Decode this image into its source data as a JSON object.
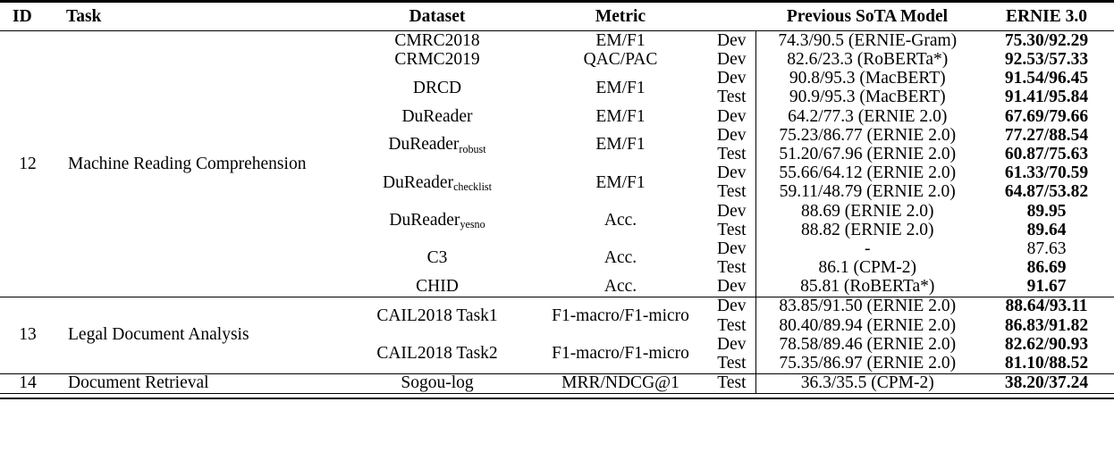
{
  "table": {
    "caption_present": false,
    "headers": {
      "id": "ID",
      "task": "Task",
      "dataset": "Dataset",
      "metric": "Metric",
      "split": "",
      "previous_sota": "Previous SoTA Model",
      "ernie": "ERNIE 3.0"
    },
    "groups": [
      {
        "id": "12",
        "task": "Machine Reading Comprehension",
        "rows": [
          {
            "dataset": "CMRC2018",
            "dataset_sub": "",
            "metric": "EM/F1",
            "split": "Dev",
            "previous_sota": "74.3/90.5 (ERNIE-Gram)",
            "ernie": "75.30/92.29",
            "ernie_bold": true
          },
          {
            "dataset": "CRMC2019",
            "dataset_sub": "",
            "metric": "QAC/PAC",
            "split": "Dev",
            "previous_sota": "82.6/23.3 (RoBERTa*)",
            "ernie": "92.53/57.33",
            "ernie_bold": true
          },
          {
            "dataset": "DRCD",
            "dataset_sub": "",
            "metric": "EM/F1",
            "split": "Dev",
            "previous_sota": "90.8/95.3 (MacBERT)",
            "ernie": "91.54/96.45",
            "ernie_bold": true
          },
          {
            "dataset": "",
            "dataset_sub": "",
            "metric": "",
            "split": "Test",
            "previous_sota": "90.9/95.3 (MacBERT)",
            "ernie": "91.41/95.84",
            "ernie_bold": true
          },
          {
            "dataset": "DuReader",
            "dataset_sub": "",
            "metric": "EM/F1",
            "split": "Dev",
            "previous_sota": "64.2/77.3 (ERNIE 2.0)",
            "ernie": "67.69/79.66",
            "ernie_bold": true
          },
          {
            "dataset": "DuReader",
            "dataset_sub": "robust",
            "metric": "EM/F1",
            "split": "Dev",
            "previous_sota": "75.23/86.77 (ERNIE 2.0)",
            "ernie": "77.27/88.54",
            "ernie_bold": true
          },
          {
            "dataset": "",
            "dataset_sub": "",
            "metric": "",
            "split": "Test",
            "previous_sota": "51.20/67.96 (ERNIE 2.0)",
            "ernie": "60.87/75.63",
            "ernie_bold": true
          },
          {
            "dataset": "DuReader",
            "dataset_sub": "checklist",
            "metric": "EM/F1",
            "split": "Dev",
            "previous_sota": "55.66/64.12 (ERNIE 2.0)",
            "ernie": "61.33/70.59",
            "ernie_bold": true
          },
          {
            "dataset": "",
            "dataset_sub": "",
            "metric": "",
            "split": "Test",
            "previous_sota": "59.11/48.79 (ERNIE 2.0)",
            "ernie": "64.87/53.82",
            "ernie_bold": true
          },
          {
            "dataset": "DuReader",
            "dataset_sub": "yesno",
            "metric": "Acc.",
            "split": "Dev",
            "previous_sota": "88.69 (ERNIE 2.0)",
            "ernie": "89.95",
            "ernie_bold": true
          },
          {
            "dataset": "",
            "dataset_sub": "",
            "metric": "",
            "split": "Test",
            "previous_sota": "88.82 (ERNIE 2.0)",
            "ernie": "89.64",
            "ernie_bold": true
          },
          {
            "dataset": "C3",
            "dataset_sub": "",
            "metric": "Acc.",
            "split": "Dev",
            "previous_sota": "-",
            "ernie": "87.63",
            "ernie_bold": false
          },
          {
            "dataset": "",
            "dataset_sub": "",
            "metric": "",
            "split": "Test",
            "previous_sota": "86.1 (CPM-2)",
            "ernie": "86.69",
            "ernie_bold": true
          },
          {
            "dataset": "CHID",
            "dataset_sub": "",
            "metric": "Acc.",
            "split": "Dev",
            "previous_sota": "85.81 (RoBERTa*)",
            "ernie": "91.67",
            "ernie_bold": true
          }
        ]
      },
      {
        "id": "13",
        "task": "Legal Document Analysis",
        "rows": [
          {
            "dataset": "CAIL2018 Task1",
            "dataset_sub": "",
            "metric": "F1-macro/F1-micro",
            "split": "Dev",
            "previous_sota": "83.85/91.50 (ERNIE 2.0)",
            "ernie": "88.64/93.11",
            "ernie_bold": true
          },
          {
            "dataset": "",
            "dataset_sub": "",
            "metric": "",
            "split": "Test",
            "previous_sota": "80.40/89.94 (ERNIE 2.0)",
            "ernie": "86.83/91.82",
            "ernie_bold": true
          },
          {
            "dataset": "CAIL2018 Task2",
            "dataset_sub": "",
            "metric": "F1-macro/F1-micro",
            "split": "Dev",
            "previous_sota": "78.58/89.46 (ERNIE 2.0)",
            "ernie": "82.62/90.93",
            "ernie_bold": true
          },
          {
            "dataset": "",
            "dataset_sub": "",
            "metric": "",
            "split": "Test",
            "previous_sota": "75.35/86.97 (ERNIE 2.0)",
            "ernie": "81.10/88.52",
            "ernie_bold": true
          }
        ]
      },
      {
        "id": "14",
        "task": "Document Retrieval",
        "rows": [
          {
            "dataset": "Sogou-log",
            "dataset_sub": "",
            "metric": "MRR/NDCG@1",
            "split": "Test",
            "previous_sota": "36.3/35.5 (CPM-2)",
            "ernie": "38.20/37.24",
            "ernie_bold": true
          }
        ]
      }
    ]
  },
  "style": {
    "rule_color": "#000000",
    "text_color": "#000000",
    "background": "#ffffff"
  }
}
